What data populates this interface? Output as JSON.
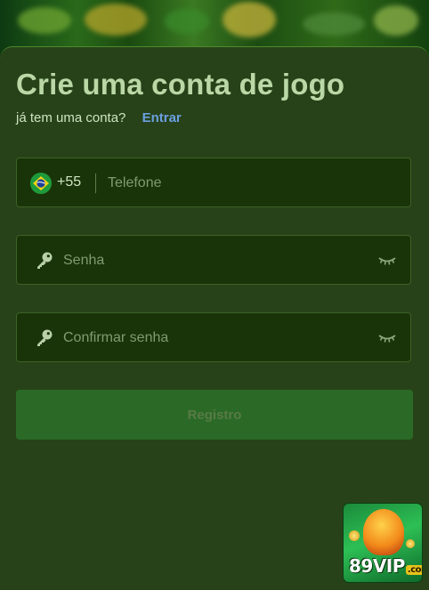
{
  "form": {
    "title": "Crie uma conta de jogo",
    "subtitle_text": "já tem uma conta?",
    "login_link": "Entrar",
    "phone": {
      "country_code": "+55",
      "flag_icon": "brazil-flag-icon",
      "placeholder": "Telefone",
      "value": ""
    },
    "password": {
      "placeholder": "Senha",
      "value": "",
      "lead_icon": "key-icon",
      "toggle_icon": "eye-closed-icon"
    },
    "confirm_password": {
      "placeholder": "Confirmar senha",
      "value": "",
      "lead_icon": "key-icon",
      "toggle_icon": "eye-closed-icon"
    },
    "submit_label": "Registro"
  },
  "promo": {
    "brand_text": "89VIP",
    "brand_suffix": ".com"
  },
  "colors": {
    "panel_bg": "#274219",
    "title": "#b9d8a6",
    "link": "#6aa0e0",
    "field_bg": "#1a3409",
    "button_bg": "#2a6a26"
  }
}
